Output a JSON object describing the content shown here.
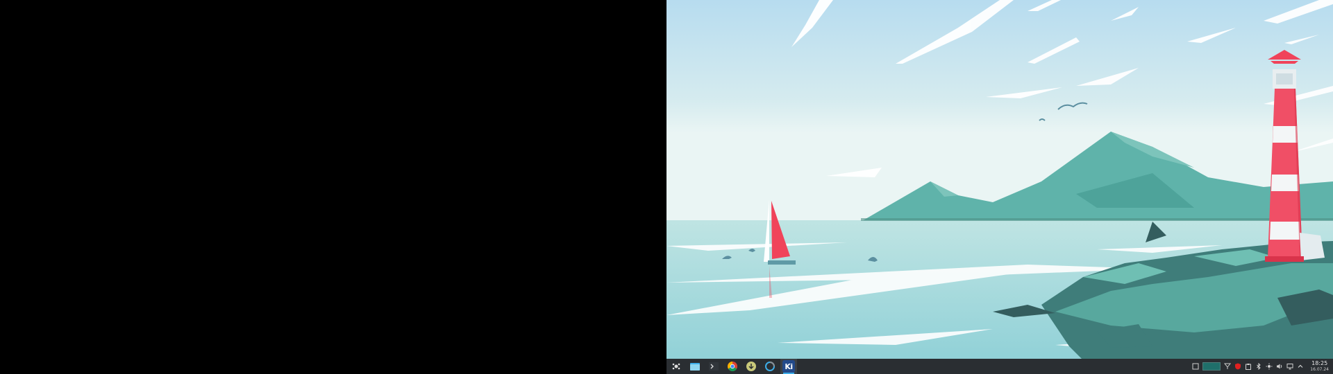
{
  "desktop": {
    "left_screen_state": "off",
    "wallpaper": "lighthouse"
  },
  "taskbar": {
    "launchers": [
      {
        "name": "application-launcher-icon"
      },
      {
        "name": "file-manager-icon"
      },
      {
        "name": "terminal-icon"
      },
      {
        "name": "chrome-icon"
      },
      {
        "name": "download-manager-icon"
      },
      {
        "name": "sync-icon"
      },
      {
        "name": "kicad-icon",
        "label": "Ki"
      }
    ],
    "tray": {
      "icons": [
        "show-desktop-icon",
        "virtual-desktop-pager",
        "vpn-icon",
        "shield-icon",
        "clipboard-icon",
        "bluetooth-icon",
        "brightness-icon",
        "volume-icon",
        "display-icon",
        "chevron-up-icon"
      ]
    },
    "clock": {
      "time": "18:25",
      "date": "16.07.24"
    }
  },
  "colors": {
    "taskbar_bg": "#2a2e32",
    "accent": "#3daee9",
    "lighthouse_red": "#f0435a",
    "water": "#a8dfe0",
    "mountain": "#5fb3aa"
  }
}
